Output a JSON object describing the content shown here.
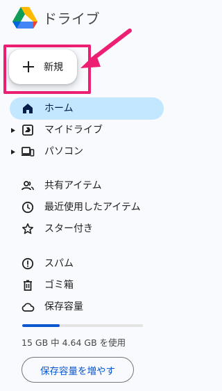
{
  "app": {
    "title": "ドライブ",
    "logo_icon": "google-drive-logo"
  },
  "new_button": {
    "label": "新規",
    "icon": "plus-icon"
  },
  "annotation": {
    "highlight_color": "#ec1f72"
  },
  "nav": {
    "items": [
      {
        "label": "ホーム",
        "icon": "home-icon",
        "active": true
      },
      {
        "label": "マイドライブ",
        "icon": "my-drive-icon",
        "expandable": true
      },
      {
        "label": "パソコン",
        "icon": "computers-icon",
        "expandable": true
      },
      {
        "label": "共有アイテム",
        "icon": "shared-people-icon"
      },
      {
        "label": "最近使用したアイテム",
        "icon": "clock-icon"
      },
      {
        "label": "スター付き",
        "icon": "star-icon"
      },
      {
        "label": "スパム",
        "icon": "spam-icon"
      },
      {
        "label": "ゴミ箱",
        "icon": "trash-icon"
      },
      {
        "label": "保存容量",
        "icon": "cloud-icon"
      }
    ]
  },
  "storage": {
    "used_fraction": 0.31,
    "text": "15 GB 中 4.64 GB を使用",
    "button_label": "保存容量を増やす"
  },
  "colors": {
    "active_bg": "#c2e7ff",
    "accent": "#0b57d0",
    "background": "#f8fafd"
  }
}
